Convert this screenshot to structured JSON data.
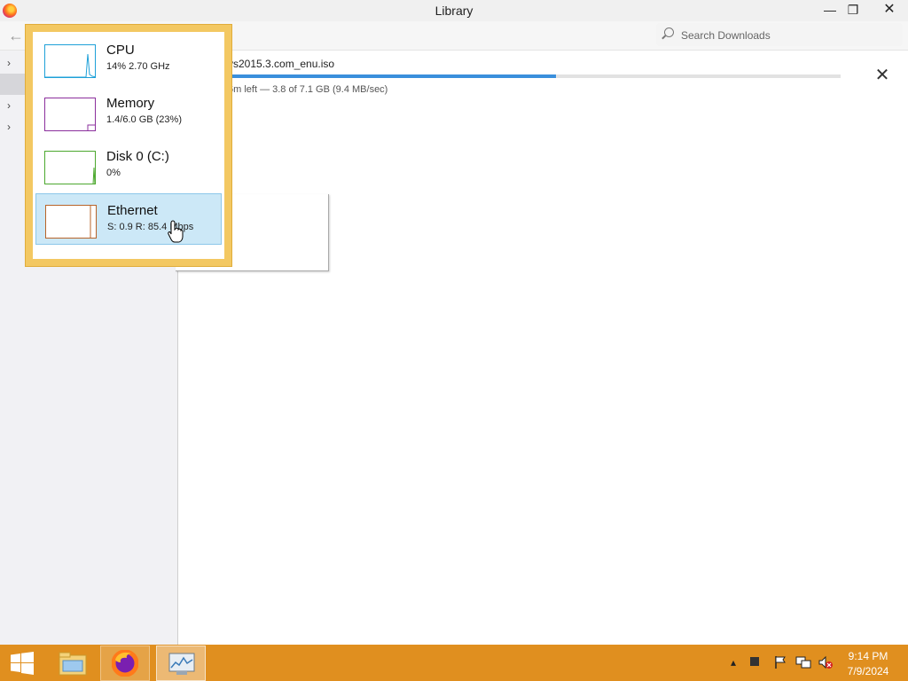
{
  "window": {
    "title": "Library",
    "minimize": "—",
    "restore": "❐",
    "close": "✕"
  },
  "toolbar": {
    "back": "←",
    "search_placeholder": "Search Downloads"
  },
  "sidebar": {
    "chevron": "›",
    "rows": 4,
    "selected_index": 1
  },
  "download": {
    "filename": "ys2015.3.com_enu.iso",
    "status": "6m left — 3.8 of 7.1 GB (9.4 MB/sec)",
    "progress": 0.535,
    "cancel": "✕"
  },
  "performance_flyout": {
    "items": [
      {
        "title": "CPU",
        "detail": "14%  2.70 GHz",
        "color": "#1ea0d8"
      },
      {
        "title": "Memory",
        "detail": "1.4/6.0 GB (23%)",
        "color": "#8b2f9c"
      },
      {
        "title": "Disk 0 (C:)",
        "detail": "0%",
        "color": "#4ca82e"
      },
      {
        "title": "Ethernet",
        "detail": "S: 0.9  R: 85.4 Mbps",
        "color": "#b8642a",
        "active": true
      }
    ],
    "border_color": "#f3c862",
    "hover_color": "#cce8f7"
  },
  "taskbar": {
    "color": "#e08f1f",
    "tray": {
      "show_hidden": "▴",
      "time": "9:14 PM",
      "date": "7/9/2024"
    }
  }
}
